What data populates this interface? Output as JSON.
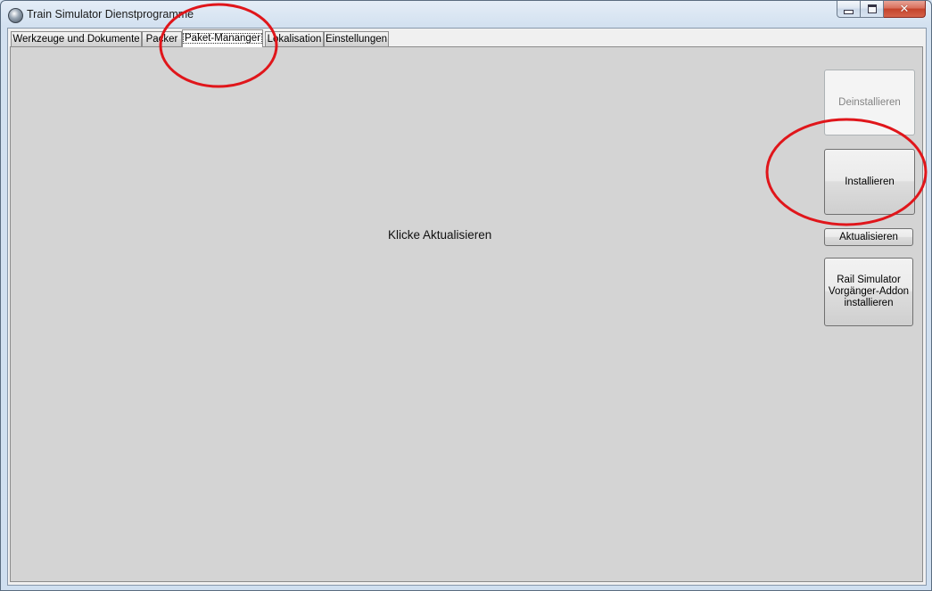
{
  "window": {
    "title": "Train Simulator Dienstprogramme",
    "caption_buttons": {
      "minimize": "minimize-icon",
      "maximize": "maximize-icon",
      "close": "✕"
    }
  },
  "tabs": [
    {
      "label": "Werkzeuge und Dokumente",
      "active": false
    },
    {
      "label": "Packer",
      "active": false
    },
    {
      "label": "Paket-Mananger",
      "active": true
    },
    {
      "label": "Lokalisation",
      "active": false
    },
    {
      "label": "Einstellungen",
      "active": false
    }
  ],
  "paket_manager": {
    "status_text": "Klicke Aktualisieren",
    "buttons": {
      "deinstallieren": {
        "label": "Deinstallieren",
        "enabled": false
      },
      "installieren": {
        "label": "Installieren",
        "enabled": true
      },
      "aktualisieren": {
        "label": "Aktualisieren",
        "enabled": true
      },
      "legacy_addon": {
        "label": "Rail Simulator\nVorgänger-Addon\ninstallieren",
        "enabled": true
      }
    }
  },
  "colors": {
    "annotation": "#e0161b",
    "tab_page_bg": "#d4d4d4",
    "window_frame": "#cfdff0"
  }
}
